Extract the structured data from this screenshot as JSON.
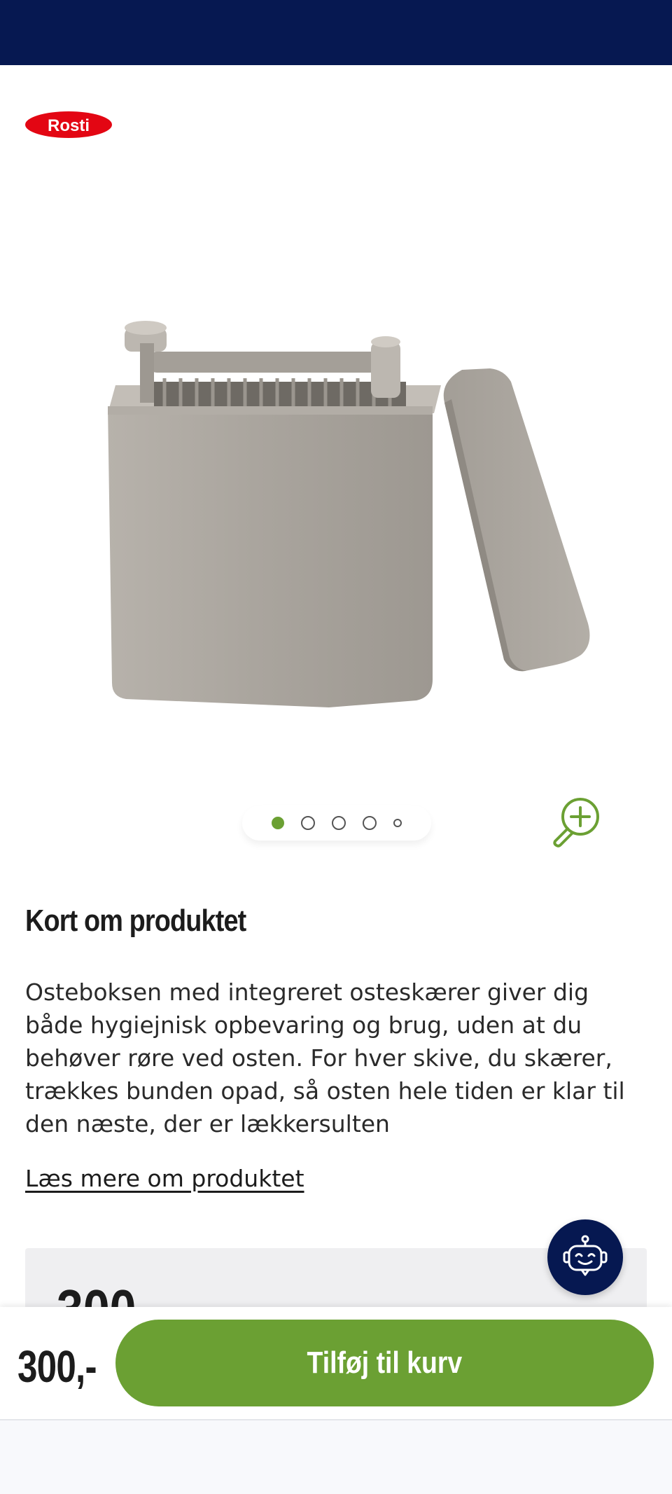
{
  "brand": {
    "logo_text": "Rosti",
    "color": "#e30613"
  },
  "colors": {
    "header": "#061851",
    "accent": "#6ba033"
  },
  "carousel": {
    "total": 5,
    "active_index": 0
  },
  "product": {
    "section_title": "Kort om produktet",
    "description": "Osteboksen med integreret osteskærer giver dig både hygiejnisk opbevaring og brug, uden at du behøver røre ved osten. For hver skive, du skærer, trækkes bunden opad, så osten hele tiden er klar til den næste, der er lækkersulten",
    "read_more": "Læs mere om produktet",
    "price_box_price": "300,-"
  },
  "bottom_bar": {
    "price": "300,-",
    "add_to_cart_label": "Tilføj til kurv"
  },
  "icons": {
    "zoom": "zoom-in-icon",
    "chat": "chat-bot-icon"
  }
}
